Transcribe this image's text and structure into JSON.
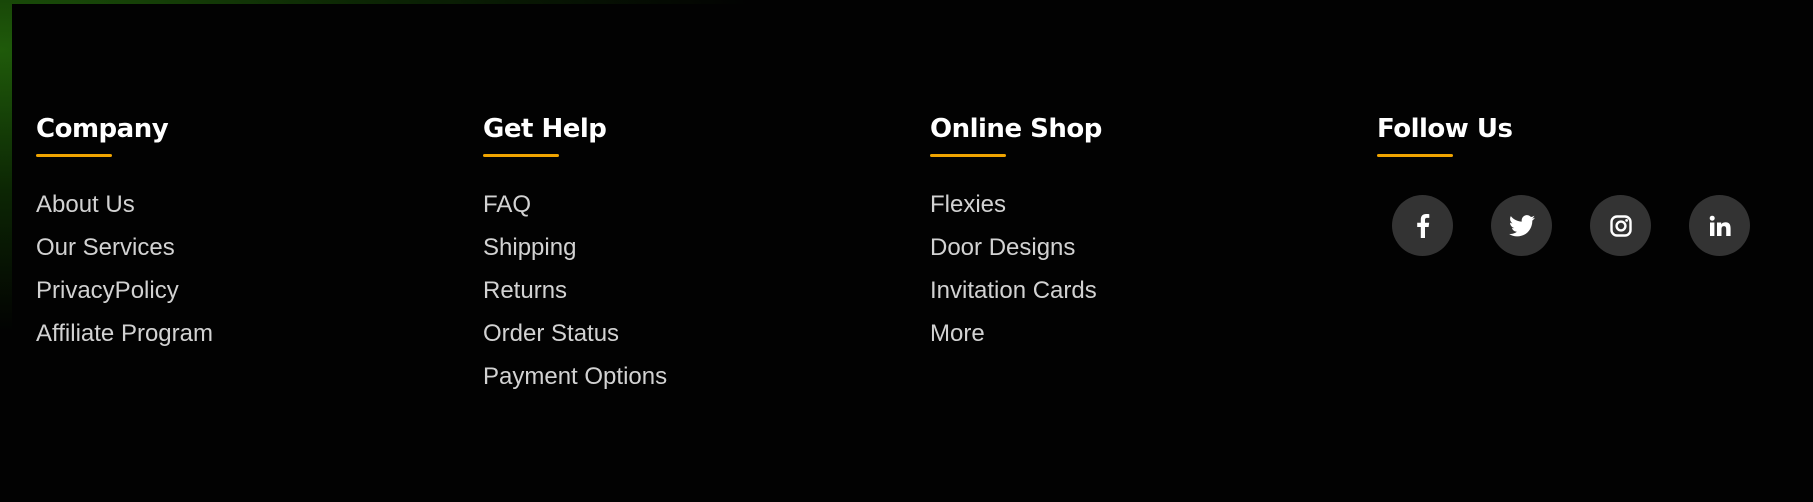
{
  "footer": {
    "company": {
      "title": "Company",
      "links": [
        "About Us",
        "Our Services",
        "PrivacyPolicy",
        "Affiliate Program"
      ]
    },
    "help": {
      "title": "Get Help",
      "links": [
        "FAQ",
        "Shipping",
        "Returns",
        "Order Status",
        "Payment Options"
      ]
    },
    "shop": {
      "title": "Online Shop",
      "links": [
        "Flexies",
        "Door Designs",
        "Invitation Cards",
        "More"
      ]
    },
    "follow": {
      "title": "Follow Us",
      "icons": [
        "facebook-icon",
        "twitter-icon",
        "instagram-icon",
        "linkedin-icon"
      ]
    }
  },
  "colors": {
    "accent": "#f0a400",
    "background": "#020202",
    "link": "#d2d2d2",
    "social_bg": "#333333"
  }
}
